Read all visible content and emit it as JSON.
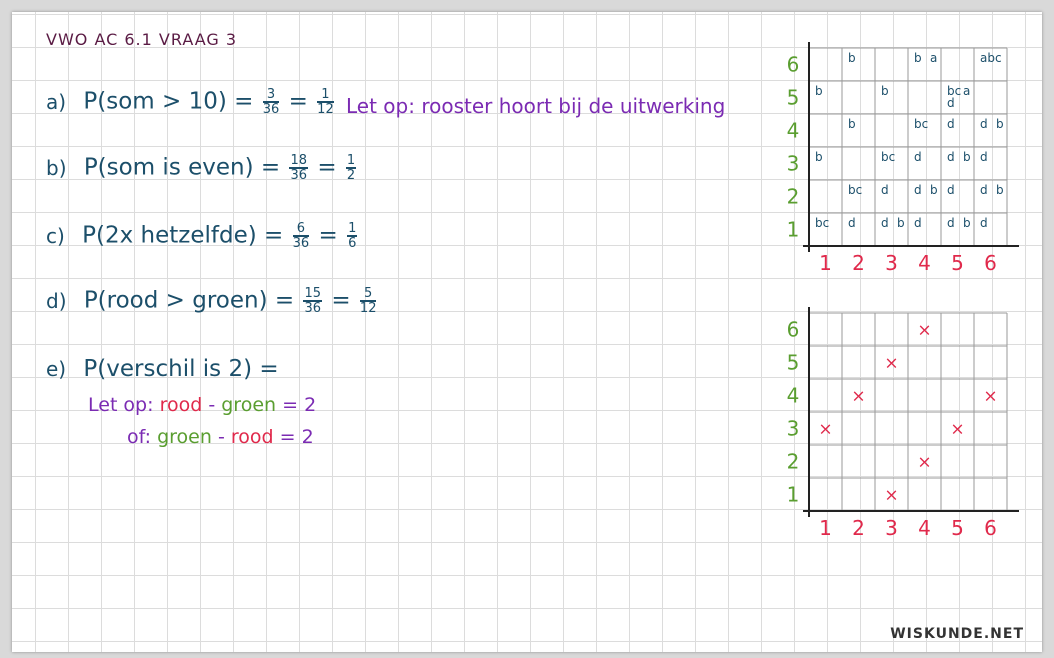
{
  "header": {
    "title": "VWO AC 6.1 VRAAG 3"
  },
  "questions": {
    "a": {
      "label": "a)",
      "text": "P(som > 10) =",
      "f1_num": "3",
      "f1_den": "36",
      "eq": "=",
      "f2_num": "1",
      "f2_den": "12",
      "note": "Let op: rooster hoort bij de uitwerking"
    },
    "b": {
      "label": "b)",
      "text": "P(som is even) =",
      "f1_num": "18",
      "f1_den": "36",
      "eq": "=",
      "f2_num": "1",
      "f2_den": "2"
    },
    "c": {
      "label": "c)",
      "text": "P(2x hetzelfde) =",
      "f1_num": "6",
      "f1_den": "36",
      "eq": "=",
      "f2_num": "1",
      "f2_den": "6"
    },
    "d": {
      "label": "d)",
      "text": "P(rood > groen) =",
      "f1_num": "15",
      "f1_den": "36",
      "eq": "=",
      "f2_num": "5",
      "f2_den": "12"
    },
    "e": {
      "label": "e)",
      "text": "P(verschil is 2) =",
      "line1_prefix": "Let op:",
      "line1_red": "rood",
      "line1_minus": "-",
      "line1_green": "groen",
      "line1_suffix": "= 2",
      "line2_prefix": "of:",
      "line2_green": "groen",
      "line2_minus": "-",
      "line2_red": "rood",
      "line2_suffix": "= 2"
    }
  },
  "grid_top": {
    "x_labels": [
      "1",
      "2",
      "3",
      "4",
      "5",
      "6"
    ],
    "y_labels": [
      "1",
      "2",
      "3",
      "4",
      "5",
      "6"
    ],
    "cells": [
      {
        "col": 1,
        "row": 6,
        "marks": []
      },
      {
        "col": 2,
        "row": 6,
        "marks": [
          "b"
        ]
      },
      {
        "col": 4,
        "row": 6,
        "marks": [
          "b",
          "a"
        ]
      },
      {
        "col": 6,
        "row": 6,
        "marks": [
          "abc"
        ]
      },
      {
        "col": 1,
        "row": 5,
        "marks": [
          "b"
        ]
      },
      {
        "col": 3,
        "row": 5,
        "marks": [
          "b"
        ]
      },
      {
        "col": 5,
        "row": 5,
        "marks": [
          "bc",
          "a",
          "d"
        ]
      },
      {
        "col": 2,
        "row": 4,
        "marks": [
          "b"
        ]
      },
      {
        "col": 4,
        "row": 4,
        "marks": [
          "bc"
        ]
      },
      {
        "col": 5,
        "row": 4,
        "marks": [
          "d"
        ]
      },
      {
        "col": 6,
        "row": 4,
        "marks": [
          "d",
          "b"
        ]
      },
      {
        "col": 1,
        "row": 3,
        "marks": [
          "b"
        ]
      },
      {
        "col": 3,
        "row": 3,
        "marks": [
          "bc"
        ]
      },
      {
        "col": 4,
        "row": 3,
        "marks": [
          "d"
        ]
      },
      {
        "col": 5,
        "row": 3,
        "marks": [
          "d",
          "b"
        ]
      },
      {
        "col": 6,
        "row": 3,
        "marks": [
          "d"
        ]
      },
      {
        "col": 2,
        "row": 2,
        "marks": [
          "bc"
        ]
      },
      {
        "col": 3,
        "row": 2,
        "marks": [
          "d"
        ]
      },
      {
        "col": 4,
        "row": 2,
        "marks": [
          "d",
          "b"
        ]
      },
      {
        "col": 5,
        "row": 2,
        "marks": [
          "d"
        ]
      },
      {
        "col": 6,
        "row": 2,
        "marks": [
          "d",
          "b"
        ]
      },
      {
        "col": 1,
        "row": 1,
        "marks": [
          "bc"
        ]
      },
      {
        "col": 2,
        "row": 1,
        "marks": [
          "d"
        ]
      },
      {
        "col": 3,
        "row": 1,
        "marks": [
          "d",
          "b"
        ]
      },
      {
        "col": 4,
        "row": 1,
        "marks": [
          "d"
        ]
      },
      {
        "col": 5,
        "row": 1,
        "marks": [
          "d",
          "b"
        ]
      },
      {
        "col": 6,
        "row": 1,
        "marks": [
          "d"
        ]
      }
    ]
  },
  "grid_bottom": {
    "x_labels": [
      "1",
      "2",
      "3",
      "4",
      "5",
      "6"
    ],
    "y_labels": [
      "1",
      "2",
      "3",
      "4",
      "5",
      "6"
    ],
    "mark_symbol": "×",
    "marks": [
      {
        "col": 4,
        "row": 6
      },
      {
        "col": 3,
        "row": 5
      },
      {
        "col": 2,
        "row": 4
      },
      {
        "col": 6,
        "row": 4
      },
      {
        "col": 1,
        "row": 3
      },
      {
        "col": 5,
        "row": 3
      },
      {
        "col": 4,
        "row": 2
      },
      {
        "col": 3,
        "row": 1
      }
    ]
  },
  "colors": {
    "x_axis": "#e0294b",
    "y_axis": "#5a9e30",
    "marks": "#1c4f6a",
    "cross": "#e0294b"
  },
  "logo": {
    "text": "WISKUNDE.NET"
  }
}
